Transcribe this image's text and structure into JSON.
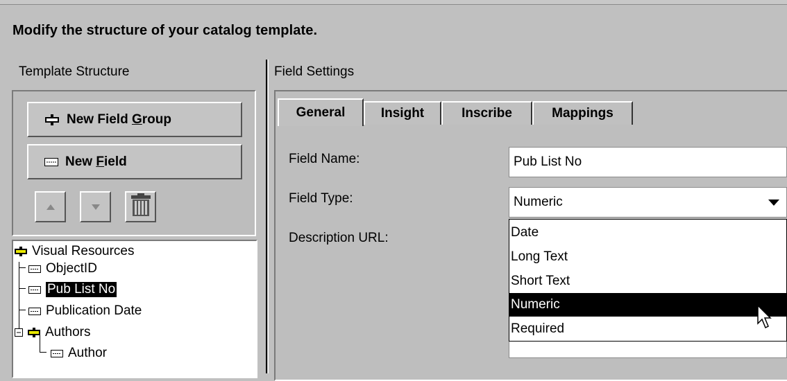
{
  "header": {
    "title": "Modify the structure of your catalog template."
  },
  "left": {
    "section_label": "Template Structure",
    "new_group": {
      "pre": "New Field ",
      "key": "G",
      "post": "roup"
    },
    "new_field": {
      "pre": "New ",
      "key": "F",
      "post": "ield"
    },
    "tree": {
      "root": "Visual Resources",
      "items": [
        "ObjectID",
        "Pub List No",
        "Publication Date"
      ],
      "group": "Authors",
      "child": "Author",
      "selected": "Pub List No"
    }
  },
  "right": {
    "section_label": "Field Settings",
    "tabs": [
      "General",
      "Insight",
      "Inscribe",
      "Mappings"
    ],
    "active_tab": "General",
    "form": {
      "field_name_label": "Field Name:",
      "field_name_value": "Pub List No",
      "field_type_label": "Field Type:",
      "field_type_value": "Numeric",
      "description_label": "Description URL:"
    },
    "dropdown_options": [
      "Date",
      "Long Text",
      "Short Text",
      "Numeric",
      "Required"
    ],
    "highlighted_option": "Numeric"
  }
}
